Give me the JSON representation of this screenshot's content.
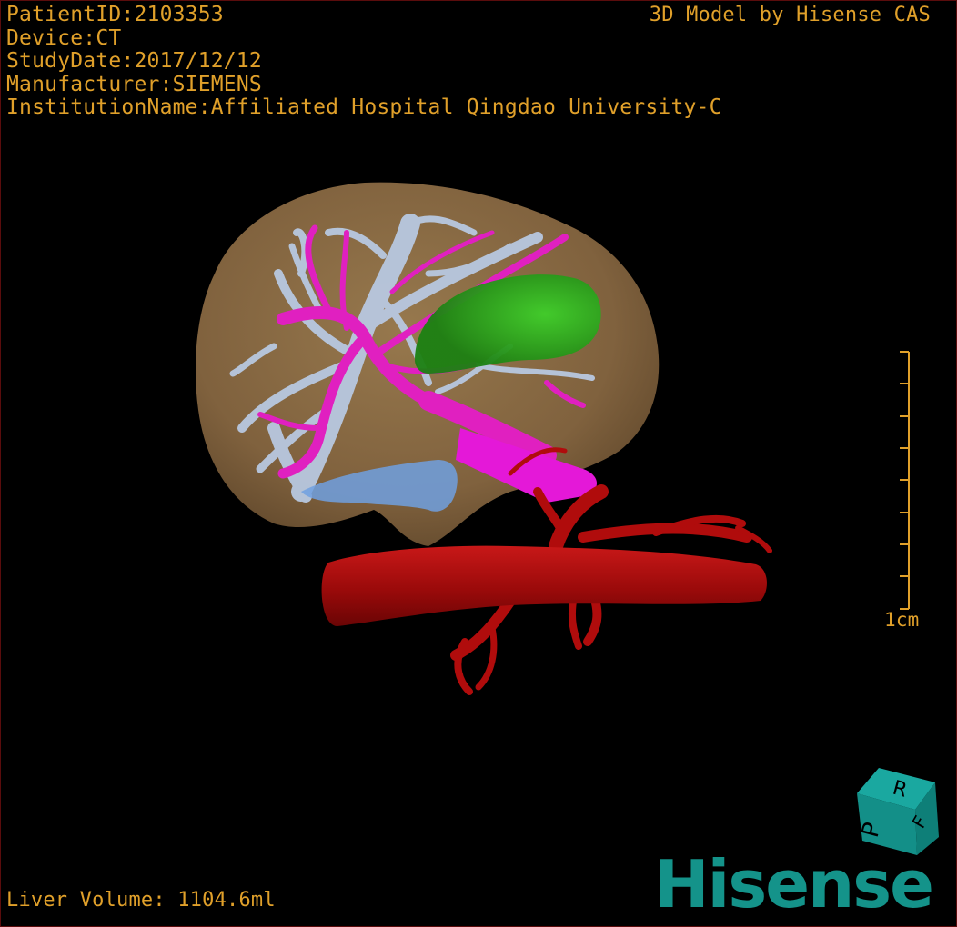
{
  "header": {
    "patient_id": "PatientID:2103353",
    "device": "Device:CT",
    "study_date": "StudyDate:2017/12/12",
    "manufacturer": "Manufacturer:SIEMENS",
    "institution": "InstitutionName:Affiliated Hospital Qingdao University-C"
  },
  "credit": "3D Model by Hisense CAS",
  "footer": {
    "liver_volume": "Liver Volume: 1104.6ml"
  },
  "scale": {
    "label": "1cm"
  },
  "orientation_cube": {
    "faces": [
      "R",
      "F",
      "P"
    ]
  },
  "brand": {
    "logo_text": "Hisense"
  },
  "colors": {
    "overlay_text": "#e0a02a",
    "liver": "#8a6a40",
    "hepatic_vein": "#b8c8e0",
    "portal_vein": "#e020c0",
    "gallbladder": "#2a9a1a",
    "artery": "#b00c0c",
    "tumor": "#70a0e0",
    "brand": "#14938a"
  }
}
